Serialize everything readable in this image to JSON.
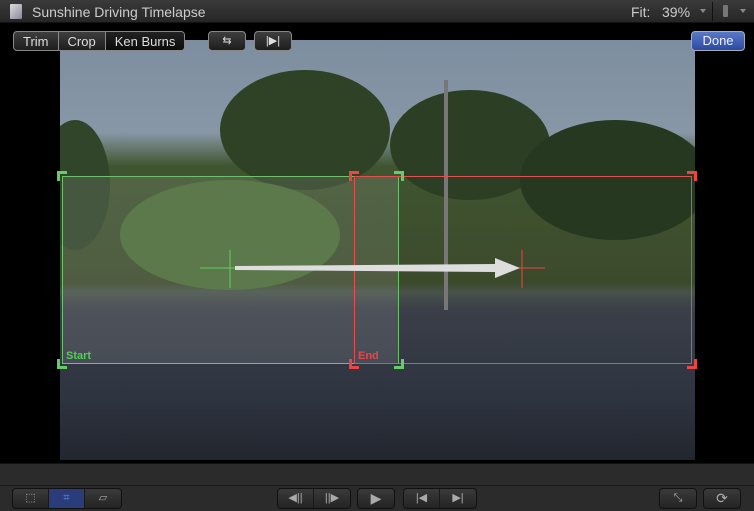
{
  "window": {
    "title": "Sunshine Driving Timelapse",
    "fit_label": "Fit:",
    "zoom": "39%"
  },
  "modes": [
    {
      "label": "Trim"
    },
    {
      "label": "Crop"
    },
    {
      "label": "Ken Burns",
      "active": true
    }
  ],
  "toolbar": {
    "swap_icon": "⇆",
    "preview_icon": "|▶|",
    "done_label": "Done"
  },
  "ken_burns": {
    "start_label": "Start",
    "end_label": "End",
    "start_color": "#6fbf6f",
    "end_color": "#e05050"
  },
  "bottom": {
    "left_tools": [
      "transform-icon",
      "crop-icon",
      "distort-icon"
    ],
    "frame_step": [
      "◀||",
      "||▶"
    ],
    "play": "▶",
    "nav": [
      "|◀",
      "▶|"
    ],
    "fullscreen": "⤡",
    "loop": "⟳"
  },
  "accent": "#3a5fc0"
}
